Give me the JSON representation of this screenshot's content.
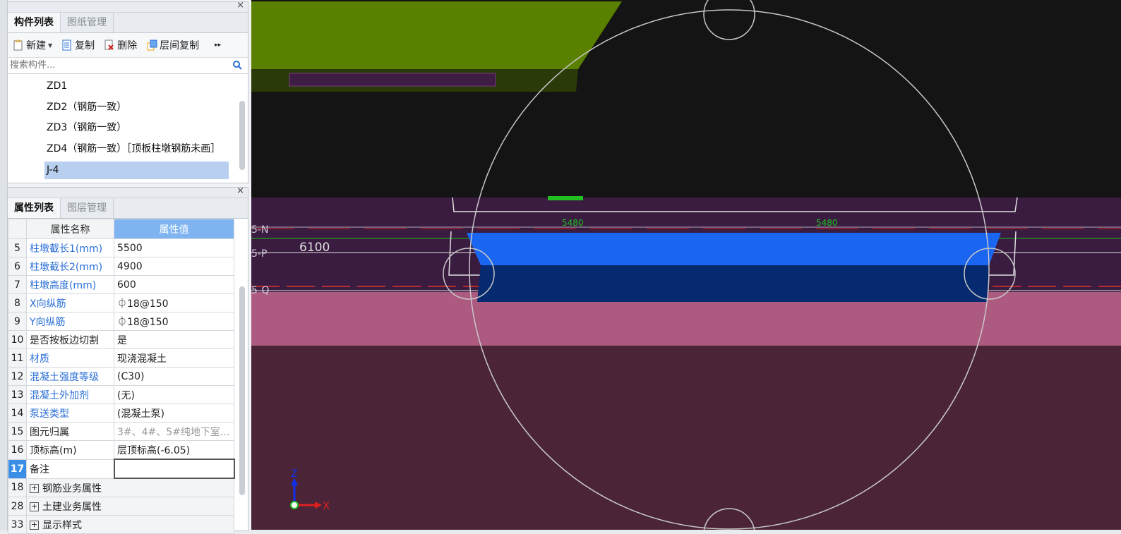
{
  "component_panel": {
    "close": "×",
    "tabs": [
      "构件列表",
      "图纸管理"
    ],
    "toolbar": {
      "new": "新建",
      "copy": "复制",
      "delete": "删除",
      "floor_copy": "层间复制",
      "more": "▸▸"
    },
    "search_placeholder": "搜索构件...",
    "items": [
      "ZD1",
      "ZD2（钢筋一致）",
      "ZD3（钢筋一致）",
      "ZD4（钢筋一致）［顶板柱墩钢筋未画］",
      "J-4"
    ],
    "selected_item": "J-4"
  },
  "property_panel": {
    "close": "×",
    "tabs": [
      "属性列表",
      "图层管理"
    ],
    "columns": [
      "属性名称",
      "属性值"
    ],
    "rows": [
      {
        "num": "5",
        "name": "柱墩截长1(mm)",
        "value": "5500",
        "blue": true
      },
      {
        "num": "6",
        "name": "柱墩截长2(mm)",
        "value": "4900",
        "blue": true
      },
      {
        "num": "7",
        "name": "柱墩高度(mm)",
        "value": "600",
        "blue": true
      },
      {
        "num": "8",
        "name": "X向纵筋",
        "value": "⏀18@150",
        "blue": true
      },
      {
        "num": "9",
        "name": "Y向纵筋",
        "value": "⏀18@150",
        "blue": true
      },
      {
        "num": "10",
        "name": "是否按板边切割",
        "value": "是",
        "blue": false
      },
      {
        "num": "11",
        "name": "材质",
        "value": "现浇混凝土",
        "blue": true
      },
      {
        "num": "12",
        "name": "混凝土强度等级",
        "value": "(C30)",
        "blue": true
      },
      {
        "num": "13",
        "name": "混凝土外加剂",
        "value": "(无)",
        "blue": true
      },
      {
        "num": "14",
        "name": "泵送类型",
        "value": "(混凝土泵)",
        "blue": true
      },
      {
        "num": "15",
        "name": "图元归属",
        "value": "3#、4#、5#纯地下室...",
        "blue": false,
        "gray": true
      },
      {
        "num": "16",
        "name": "顶标高(m)",
        "value": "层顶标高(-6.05)",
        "blue": false
      },
      {
        "num": "17",
        "name": "备注",
        "value": "",
        "blue": false,
        "selected": true
      },
      {
        "num": "18",
        "name": "钢筋业务属性",
        "value": "",
        "group": true
      },
      {
        "num": "28",
        "name": "土建业务属性",
        "value": "",
        "group": true
      },
      {
        "num": "33",
        "name": "显示样式",
        "value": "",
        "group": true
      }
    ]
  },
  "viewport": {
    "dim_label_1": "5480",
    "dim_label_2": "5480",
    "text_value": "6100",
    "axis_label_n": "5-N",
    "axis_label_p": "5-P",
    "axis_label_q": "5-Q",
    "axis_x": "X",
    "axis_z": "Z",
    "colors": {
      "green_slab": "#5a8000",
      "purple_band": "#3a1c40",
      "pink_band": "#ac5a80",
      "maroon_band": "#4b2537",
      "pier_top": "#1a66f0",
      "pier_front": "#062a70"
    }
  }
}
